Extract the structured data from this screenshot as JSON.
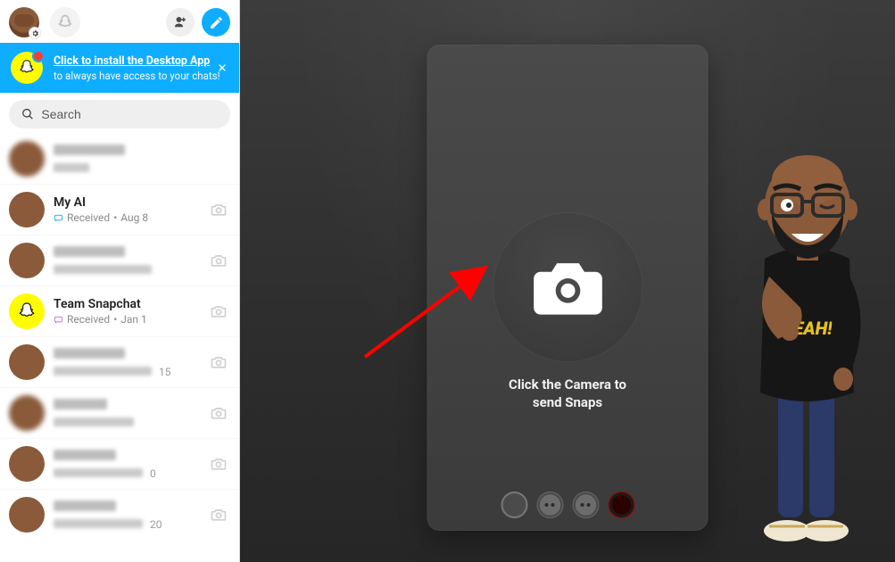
{
  "topbar": {
    "avatar_gear_label": "Settings"
  },
  "banner": {
    "title": "Click to install the Desktop App",
    "subtitle": "to always have access to your chats!"
  },
  "search": {
    "placeholder": "Search"
  },
  "chats": [
    {
      "name": "",
      "sub": "",
      "blurred": true
    },
    {
      "name": "My AI",
      "status": "Received",
      "date": "Aug 8",
      "status_icon": "chat"
    },
    {
      "name": "",
      "sub": "",
      "blurred": true
    },
    {
      "name": "Team Snapchat",
      "status": "Received",
      "date": "Jan 1",
      "status_icon": "chat"
    },
    {
      "name": "",
      "sub": "15",
      "blurred": true
    },
    {
      "name": "",
      "sub": "",
      "blurred": true
    },
    {
      "name": "",
      "sub": "0",
      "blurred": true
    },
    {
      "name": "",
      "sub": "20",
      "blurred": true
    }
  ],
  "camera": {
    "label_line1": "Click the Camera to",
    "label_line2": "send Snaps"
  }
}
